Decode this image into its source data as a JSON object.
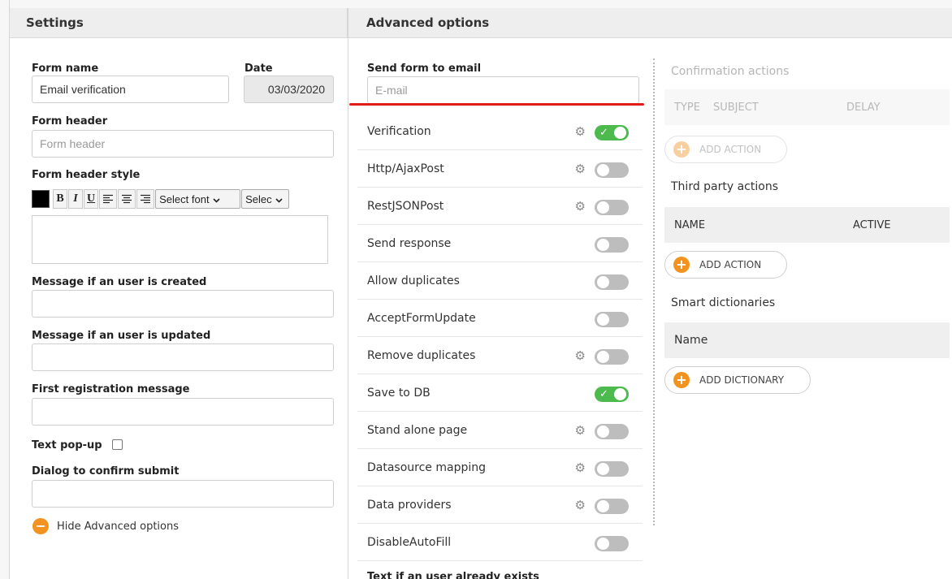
{
  "settings_panel": {
    "title": "Settings",
    "form_name": {
      "label": "Form name",
      "value": "Email verification"
    },
    "date": {
      "label": "Date",
      "value": "03/03/2020"
    },
    "form_header": {
      "label": "Form header",
      "placeholder": "Form header"
    },
    "form_header_style": {
      "label": "Form header style",
      "toolbar": {
        "bold": "B",
        "italic": "I",
        "underline": "U",
        "font_select": "Select font",
        "size_select": "Selec"
      }
    },
    "msg_user_created": {
      "label": "Message if an user is created",
      "value": ""
    },
    "msg_user_updated": {
      "label": "Message if an user is updated",
      "value": ""
    },
    "first_registration_message": {
      "label": "First registration message",
      "value": ""
    },
    "text_popup": {
      "label": "Text pop-up",
      "checked": false
    },
    "dialog_confirm_submit": {
      "label": "Dialog to confirm submit",
      "value": ""
    },
    "hide_advanced": {
      "label": "Hide Advanced options"
    }
  },
  "advanced_panel": {
    "title": "Advanced options",
    "send_form_to_email": {
      "label": "Send form to email",
      "placeholder": "E-mail"
    },
    "options": [
      {
        "label": "Verification",
        "gear": true,
        "on": true
      },
      {
        "label": "Http/AjaxPost",
        "gear": true,
        "on": false
      },
      {
        "label": "RestJSONPost",
        "gear": true,
        "on": false
      },
      {
        "label": "Send response",
        "gear": false,
        "on": false
      },
      {
        "label": "Allow duplicates",
        "gear": false,
        "on": false
      },
      {
        "label": "AcceptFormUpdate",
        "gear": false,
        "on": false
      },
      {
        "label": "Remove duplicates",
        "gear": true,
        "on": false
      },
      {
        "label": "Save to DB",
        "gear": false,
        "on": true
      },
      {
        "label": "Stand alone page",
        "gear": true,
        "on": false
      },
      {
        "label": "Datasource mapping",
        "gear": true,
        "on": false
      },
      {
        "label": "Data providers",
        "gear": true,
        "on": false
      },
      {
        "label": "DisableAutoFill",
        "gear": false,
        "on": false
      }
    ],
    "text_user_exists_label": "Text if an user already exists"
  },
  "actions_panel": {
    "confirmation_actions": {
      "title": "Confirmation actions",
      "columns": [
        "TYPE",
        "SUBJECT",
        "DELAY"
      ],
      "add_button": "ADD ACTION"
    },
    "third_party_actions": {
      "title": "Third party actions",
      "columns": [
        "NAME",
        "ACTIVE"
      ],
      "add_button": "ADD ACTION"
    },
    "smart_dictionaries": {
      "title": "Smart dictionaries",
      "columns": [
        "Name"
      ],
      "add_button": "ADD DICTIONARY"
    }
  }
}
